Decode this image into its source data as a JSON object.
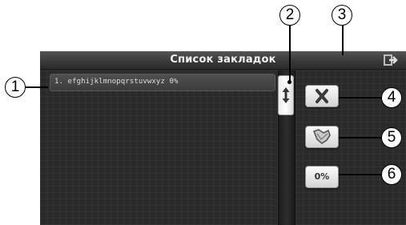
{
  "screen": {
    "title": "Список закладок"
  },
  "bookmarks": {
    "items": [
      {
        "label": "1. efghijklmnopqrstuvwxyz 0%"
      }
    ]
  },
  "buttons": {
    "delete_icon": "close-icon",
    "bookmark_icon": "bookmark-icon",
    "percent_label": "0%",
    "exit_icon": "exit-icon",
    "scroll_icon": "scroll-arrows-icon"
  },
  "callouts": [
    "1",
    "2",
    "3",
    "4",
    "5",
    "6"
  ]
}
